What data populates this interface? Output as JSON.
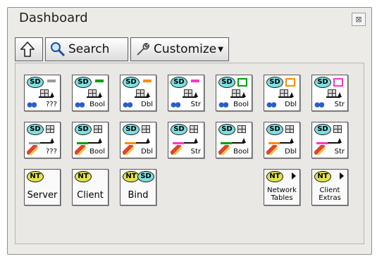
{
  "palette": {
    "title": "Dashboard",
    "close_glyph": "⊠"
  },
  "toolbar": {
    "up_icon": "up-arrow-icon",
    "search_label": "Search",
    "customize_label": "Customize"
  },
  "vi_rows": [
    {
      "row": "read",
      "items": [
        {
          "badge": "SD",
          "label": "???",
          "color": "#9a9a9a"
        },
        {
          "badge": "SD",
          "label": "Bool",
          "color": "#00a000"
        },
        {
          "badge": "SD",
          "label": "Dbl",
          "color": "#ff8a00"
        },
        {
          "badge": "SD",
          "label": "Str",
          "color": "#ff33cc"
        },
        {
          "badge": "SD",
          "label": "Bool",
          "color": "#00a000"
        },
        {
          "badge": "SD",
          "label": "Dbl",
          "color": "#ff8a00"
        },
        {
          "badge": "SD",
          "label": "Str",
          "color": "#ff33cc"
        }
      ]
    },
    {
      "row": "write",
      "items": [
        {
          "badge": "SD",
          "label": "???",
          "color": "#9a9a9a"
        },
        {
          "badge": "SD",
          "label": "Bool",
          "color": "#00a000"
        },
        {
          "badge": "SD",
          "label": "Dbl",
          "color": "#ff8a00"
        },
        {
          "badge": "SD",
          "label": "Str",
          "color": "#ff33cc"
        },
        {
          "badge": "SD",
          "label": "Bool",
          "color": "#00a000"
        },
        {
          "badge": "SD",
          "label": "Dbl",
          "color": "#ff8a00"
        },
        {
          "badge": "SD",
          "label": "Str",
          "color": "#ff33cc"
        }
      ]
    }
  ],
  "nt_items": [
    {
      "badge": "NT",
      "label": "Server"
    },
    {
      "badge": "NT",
      "label": "Client"
    },
    {
      "badge": "NT",
      "badge2": "SD",
      "label": "Bind"
    }
  ],
  "nt_folders": [
    {
      "badge": "NT",
      "label": "Network\nTables"
    },
    {
      "badge": "NT",
      "label": "Client\nExtras"
    }
  ]
}
